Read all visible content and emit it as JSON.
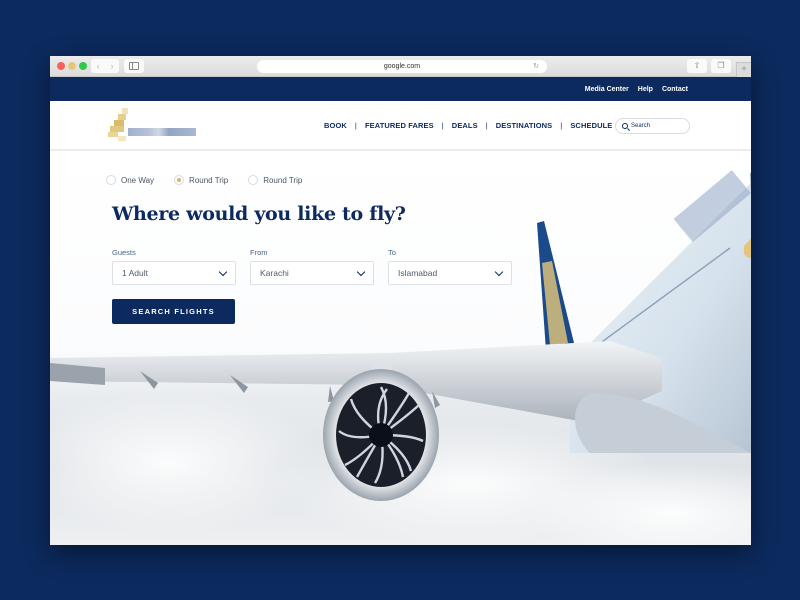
{
  "browser": {
    "url": "google.com"
  },
  "utility_nav": {
    "items": [
      "Media Center",
      "Help",
      "Contact"
    ]
  },
  "header": {
    "nav": [
      "BOOK",
      "FEATURED FARES",
      "DEALS",
      "DESTINATIONS",
      "SCHEDULE"
    ],
    "separator": "|",
    "search_placeholder": "Search"
  },
  "booking": {
    "trip_types": [
      {
        "label": "One Way",
        "selected": false
      },
      {
        "label": "Round Trip",
        "selected": true
      },
      {
        "label": "Round Trip",
        "selected": false
      }
    ],
    "title": "Where would you like to fly?",
    "fields": [
      {
        "label": "Guests",
        "value": "1 Adult"
      },
      {
        "label": "From",
        "value": "Karachi"
      },
      {
        "label": "To",
        "value": "Islamabad"
      }
    ],
    "submit_label": "SEARCH FLIGHTS"
  },
  "colors": {
    "brand_navy": "#0c2a5e",
    "accent_gold": "#d5b56f"
  }
}
